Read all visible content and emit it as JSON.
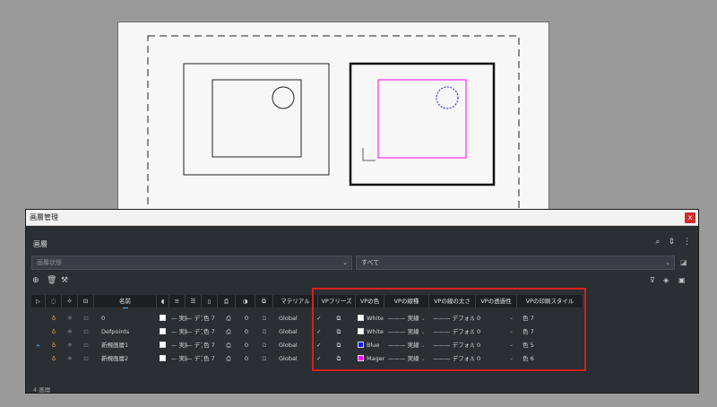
{
  "window": {
    "title": "画層管理",
    "close_glyph": "x",
    "panel_title": "画層"
  },
  "header_icons": [
    "search-icon",
    "sort-icon",
    "more-icon"
  ],
  "filters": {
    "state_placeholder": "画層状態",
    "filter_value": "すべて"
  },
  "toolbar": {
    "new_icon": "add-icon",
    "delete_icon": "delete-icon",
    "purge_icon": "brush-icon",
    "right_icons": [
      "filter-icon",
      "layer-states-icon",
      "vp-icon"
    ]
  },
  "columns": [
    {
      "label": ""
    },
    {
      "label": ""
    },
    {
      "label": ""
    },
    {
      "label": ""
    },
    {
      "label": "名前"
    },
    {
      "label": ""
    },
    {
      "label": ""
    },
    {
      "label": ""
    },
    {
      "label": ""
    },
    {
      "label": ""
    },
    {
      "label": ""
    },
    {
      "label": ""
    },
    {
      "label": "マテリアル"
    },
    {
      "label": "VPフリーズ"
    },
    {
      "label": "VPの色"
    },
    {
      "label": "VPの線種"
    },
    {
      "label": "VPの線の太さ"
    },
    {
      "label": "VPの透過性"
    },
    {
      "label": "VPの印刷スタイル"
    }
  ],
  "rows": [
    {
      "current": false,
      "name": "0",
      "color_name": "White",
      "color_short": "白",
      "color_hex": "#ffffff",
      "linetype": "実線",
      "lineweight": "デフォル",
      "transparency": "0",
      "plotstyle": "色 7",
      "material": "Global",
      "vp_color_name": "White",
      "vp_color_hex": "#ffffff",
      "vp_linetype": "実線",
      "vp_lineweight": "デフォル",
      "vp_transparency": "0",
      "vp_plotstyle": "色 7",
      "num": "0"
    },
    {
      "current": false,
      "name": "Defpoints",
      "color_name": "White",
      "color_short": "白",
      "color_hex": "#ffffff",
      "linetype": "実線",
      "lineweight": "デフォル",
      "transparency": "0",
      "plotstyle": "色 7",
      "material": "Global",
      "vp_color_name": "White",
      "vp_color_hex": "#ffffff",
      "vp_linetype": "実線",
      "vp_lineweight": "デフォル",
      "vp_transparency": "0",
      "vp_plotstyle": "色 7",
      "num": "0"
    },
    {
      "current": true,
      "name": "新規画層1",
      "color_name": "White",
      "color_short": "白",
      "color_hex": "#ffffff",
      "linetype": "実線",
      "lineweight": "デフォル",
      "transparency": "0",
      "plotstyle": "色 7",
      "material": "Global",
      "vp_color_name": "Blue",
      "vp_color_hex": "#1a1aff",
      "vp_linetype": "実線",
      "vp_lineweight": "デフォル",
      "vp_transparency": "0",
      "vp_plotstyle": "色 5",
      "num": "0"
    },
    {
      "current": false,
      "name": "新規画層2",
      "color_name": "White",
      "color_short": "白",
      "color_hex": "#ffffff",
      "linetype": "実線",
      "lineweight": "デフォル",
      "transparency": "0",
      "plotstyle": "色 7",
      "material": "Global",
      "vp_color_name": "Mager",
      "vp_color_hex": "#ff00ff",
      "vp_linetype": "実線",
      "vp_lineweight": "デフォル",
      "vp_transparency": "0",
      "vp_plotstyle": "色 6",
      "num": "0"
    }
  ],
  "status": "4 画層",
  "accent": "#d42020"
}
